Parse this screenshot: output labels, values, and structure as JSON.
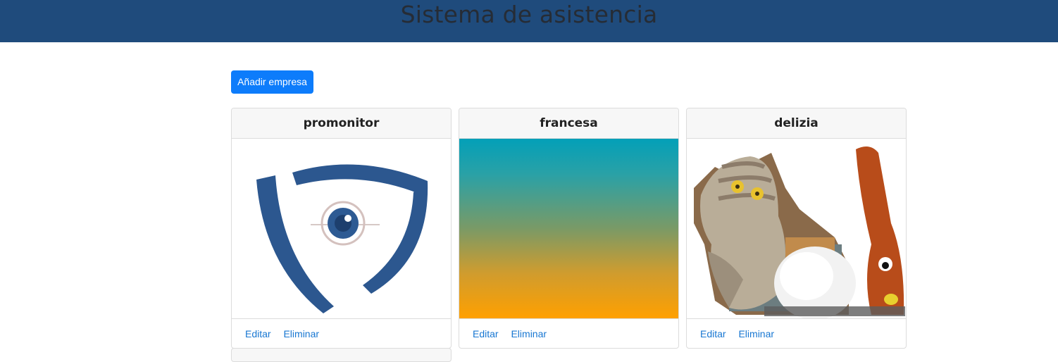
{
  "header": {
    "title": "Sistema de asistencia"
  },
  "toolbar": {
    "add_label": "Añadir empresa"
  },
  "cards": [
    {
      "title": "promonitor",
      "image": "shield-eye-logo",
      "edit_label": "Editar",
      "delete_label": "Eliminar"
    },
    {
      "title": "francesa",
      "image": "teal-orange-gradient",
      "edit_label": "Editar",
      "delete_label": "Eliminar"
    },
    {
      "title": "delizia",
      "image": "sock-puppets-photo",
      "edit_label": "Editar",
      "delete_label": "Eliminar"
    }
  ],
  "colors": {
    "header_bg": "#1f4b7c",
    "primary": "#0d7cfb",
    "link": "#1877d2"
  }
}
